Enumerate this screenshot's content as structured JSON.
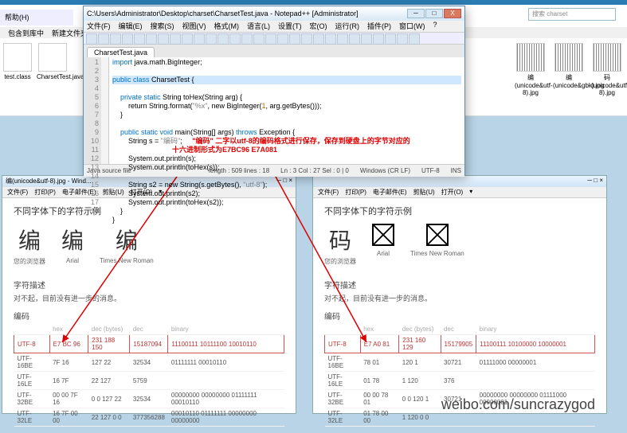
{
  "explorer": {
    "menu_help": "帮助(H)",
    "btn_include": "包含到库中",
    "btn_newfolder": "新建文件夹",
    "files": [
      {
        "name": "test.class"
      },
      {
        "name": "CharsetTest.java"
      }
    ],
    "right_files": [
      {
        "name": "编 (unicode&utf-8).jpg"
      },
      {
        "name": "编 (unicode&gbk).jpg"
      },
      {
        "name": "码 (unicode&utf-8).jpg"
      }
    ],
    "search_placeholder": "搜索 charset"
  },
  "npp": {
    "title": "C:\\Users\\Administrator\\Desktop\\charset\\CharsetTest.java - Notepad++ [Administrator]",
    "menu": [
      "文件(F)",
      "编辑(E)",
      "搜索(S)",
      "视图(V)",
      "格式(M)",
      "语言(L)",
      "设置(T)",
      "宏(O)",
      "运行(R)",
      "插件(P)",
      "窗口(W)",
      "?"
    ],
    "tab": "CharsetTest.java",
    "gutter": [
      "1",
      "2",
      "3",
      "4",
      "5",
      "6",
      "7",
      "8",
      "9",
      "10",
      "11",
      "12",
      "13",
      "14",
      "15",
      "16",
      "17",
      "18"
    ],
    "code": {
      "l1": "import java.math.BigInteger;",
      "l3": "public class CharsetTest {",
      "l4": "    private static String toHex(String arg) {",
      "l5a": "        return String.format(",
      "l5b": "\"%x\"",
      "l5c": ", new BigInteger(",
      "l5d": "1",
      "l5e": ", arg.getBytes()));",
      "l6": "    }",
      "l8": "    public static void main(String[] args) throws Exception {",
      "l9a": "        String s = ",
      "l9b": "\"编码\"",
      "l9c": ";",
      "cmt1": "\"编码\" 二字以utf-8的编码格式进行保存，保存到硬盘上的字节对应的",
      "cmt2": "十六进制形式为E7BC96 E7A081",
      "l11": "        System.out.println(s);",
      "l12": "        System.out.println(toHex(s));",
      "l14a": "        String s2 = new String(s.getBytes(), ",
      "l14b": "\"utf-8\"",
      "l14c": ");",
      "l15": "        System.out.println(s2);",
      "l16": "        System.out.println(toHex(s2));",
      "l17": "    }",
      "l18": "}"
    },
    "status": {
      "type": "Java source file",
      "len": "length : 509    lines : 18",
      "pos": "Ln : 3    Col : 27    Sel : 0 | 0",
      "eol": "Windows (CR LF)",
      "enc": "UTF-8",
      "ins": "INS"
    }
  },
  "wordpad_left": {
    "title": "编(unicode&utf-8).jpg - Wind...",
    "menu": [
      "文件(F)",
      "打印(P)",
      "电子邮件(E)",
      "剪贴(U)",
      "打开(O)"
    ],
    "h1": "不同字体下的字符示例",
    "glyphs": [
      {
        "g": "编",
        "l": "您的浏览器"
      },
      {
        "g": "编",
        "l": "Arial"
      },
      {
        "g": "编",
        "l": "Times New Roman"
      }
    ],
    "sect_desc": "字符描述",
    "desc": "对不起，目前没有进一步的消息。",
    "sect_enc": "编码",
    "thead": [
      "",
      "hex",
      "dec (bytes)",
      "dec",
      "binary"
    ],
    "rows": [
      {
        "n": "UTF-8",
        "hex": "E7 BC 96",
        "db": "231 188 150",
        "d": "15187094",
        "b": "11100111 10111100 10010110",
        "hl": true
      },
      {
        "n": "UTF-16BE",
        "hex": "7F 16",
        "db": "127 22",
        "d": "32534",
        "b": "01111111 00010110"
      },
      {
        "n": "UTF-16LE",
        "hex": "16 7F",
        "db": "22 127",
        "d": "5759",
        "b": ""
      },
      {
        "n": "UTF-32BE",
        "hex": "00 00 7F 16",
        "db": "0 0 127 22",
        "d": "32534",
        "b": "00000000 00000000 01111111 00010110"
      },
      {
        "n": "UTF-32LE",
        "hex": "16 7F 00 00",
        "db": "22 127 0 0",
        "d": "377356288",
        "b": "00010110 01111111 00000000 00000000"
      }
    ]
  },
  "wordpad_right": {
    "title": "",
    "menu": [
      "文件(F)",
      "打印(P)",
      "电子邮件(E)",
      "剪贴(U)",
      "打开(O)"
    ],
    "h1": "不同字体下的字符示例",
    "glyphs": [
      {
        "g": "码",
        "l": "您的浏览器",
        "box": false
      },
      {
        "g": "",
        "l": "Arial",
        "box": true
      },
      {
        "g": "",
        "l": "Times New Roman",
        "box": true
      }
    ],
    "sect_desc": "字符描述",
    "desc": "对不起，目前没有进一步的消息。",
    "sect_enc": "编码",
    "thead": [
      "",
      "hex",
      "dec (bytes)",
      "dec",
      "binary"
    ],
    "rows": [
      {
        "n": "UTF-8",
        "hex": "E7 A0 81",
        "db": "231 160 129",
        "d": "15179905",
        "b": "11100111 10100000 10000001",
        "hl": true
      },
      {
        "n": "UTF-16BE",
        "hex": "78 01",
        "db": "120 1",
        "d": "30721",
        "b": "01111000 00000001"
      },
      {
        "n": "UTF-16LE",
        "hex": "01 78",
        "db": "1 120",
        "d": "376",
        "b": ""
      },
      {
        "n": "UTF-32BE",
        "hex": "00 00 78 01",
        "db": "0 0 120 1",
        "d": "30721",
        "b": "00000000 00000000 01111000 00000001"
      },
      {
        "n": "UTF-32LE",
        "hex": "01 78 00 00",
        "db": "1 120 0 0",
        "d": "",
        "b": ""
      }
    ]
  },
  "watermark": "weibo.com/suncrazygod"
}
